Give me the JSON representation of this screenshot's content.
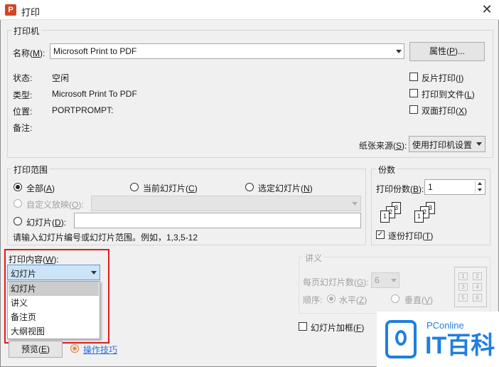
{
  "window": {
    "title": "打印",
    "app_icon_letter": "P"
  },
  "printer": {
    "group_title": "打印机",
    "name_label": "名称",
    "name_key": "M",
    "name_value": "Microsoft Print to PDF",
    "properties_label": "属性",
    "properties_key": "P",
    "status_label": "状态:",
    "status_value": "空闲",
    "type_label": "类型:",
    "type_value": "Microsoft Print To PDF",
    "location_label": "位置:",
    "location_value": "PORTPROMPT:",
    "comment_label": "备注:",
    "reverse_print": {
      "label": "反片打印",
      "key": "I"
    },
    "print_to_file": {
      "label": "打印到文件",
      "key": "L"
    },
    "duplex": {
      "label": "双面打印",
      "key": "X"
    },
    "paper_source_label": "纸张来源",
    "paper_source_key": "S",
    "paper_source_value": "使用打印机设置"
  },
  "range": {
    "group_title": "打印范围",
    "all": {
      "label": "全部",
      "key": "A"
    },
    "current": {
      "label": "当前幻灯片",
      "key": "C"
    },
    "selection": {
      "label": "选定幻灯片",
      "key": "N"
    },
    "custom_show": {
      "label": "自定义放映",
      "key": "O"
    },
    "slides": {
      "label": "幻灯片",
      "key": "D"
    },
    "hint": "请输入幻灯片编号或幻灯片范围。例如，1,3,5-12"
  },
  "copies": {
    "group_title": "份数",
    "count_label": "打印份数",
    "count_key": "B",
    "count_value": "1",
    "collate": {
      "label": "逐份打印",
      "key": "T"
    },
    "page_numbers": [
      "1",
      "2",
      "3"
    ]
  },
  "content": {
    "label": "打印内容",
    "key": "W",
    "selected": "幻灯片",
    "options": [
      "幻灯片",
      "讲义",
      "备注页",
      "大纲视图"
    ]
  },
  "handout": {
    "group_title": "讲义",
    "per_page_label": "每页幻灯片数",
    "per_page_key": "G",
    "per_page_value": "6",
    "order_label": "顺序:",
    "horizontal": {
      "label": "水平",
      "key": "Z"
    },
    "vertical": {
      "label": "垂直",
      "key": "V"
    },
    "layout_numbers": [
      "1",
      "2",
      "3",
      "4",
      "5",
      "6"
    ]
  },
  "frame_slides": {
    "label": "幻灯片加框",
    "key": "F"
  },
  "preview": {
    "label": "预览",
    "key": "E"
  },
  "tips_link": "操作技巧",
  "watermark": {
    "top": "PConline",
    "bottom": "IT百科"
  },
  "colors": {
    "highlight_border": "#e0191c",
    "selected_option_bg": "#cccccc",
    "watermark_blue": "#1e7fe0"
  }
}
